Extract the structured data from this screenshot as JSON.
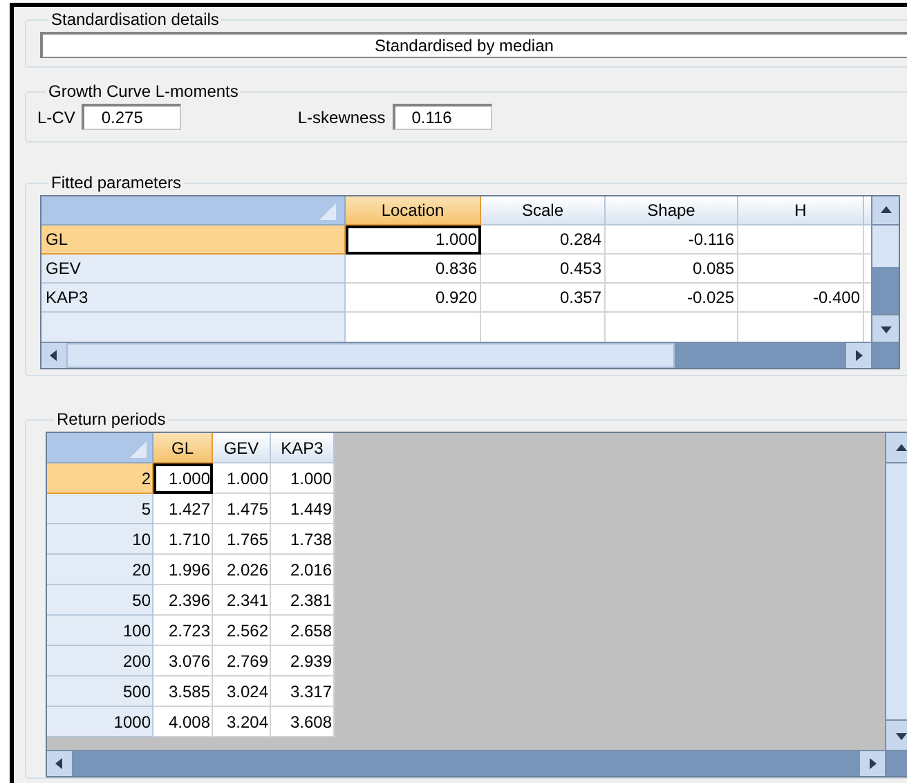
{
  "standardisation": {
    "title": "Standardisation details",
    "value": "Standardised by median"
  },
  "lmoments": {
    "title": "Growth Curve L-moments",
    "fields": [
      {
        "label": "L-CV",
        "value": "0.275"
      },
      {
        "label": "L-skewness",
        "value": "0.116"
      }
    ]
  },
  "fitted_parameters": {
    "title": "Fitted parameters",
    "columns": [
      {
        "label": "Location",
        "selected": true
      },
      {
        "label": "Scale",
        "selected": false
      },
      {
        "label": "Shape",
        "selected": false
      },
      {
        "label": "H",
        "selected": false
      }
    ],
    "rows": [
      {
        "name": "GL",
        "selected": true,
        "cells": [
          "1.000",
          "0.284",
          "-0.116",
          ""
        ]
      },
      {
        "name": "GEV",
        "selected": false,
        "cells": [
          "0.836",
          "0.453",
          "0.085",
          ""
        ]
      },
      {
        "name": "KAP3",
        "selected": false,
        "cells": [
          "0.920",
          "0.357",
          "-0.025",
          "-0.400"
        ]
      }
    ]
  },
  "return_periods": {
    "title": "Return periods",
    "columns": [
      {
        "label": "GL",
        "selected": true
      },
      {
        "label": "GEV",
        "selected": false
      },
      {
        "label": "KAP3",
        "selected": false
      }
    ],
    "rows": [
      {
        "name": "2",
        "selected": true,
        "cells": [
          "1.000",
          "1.000",
          "1.000"
        ]
      },
      {
        "name": "5",
        "selected": false,
        "cells": [
          "1.427",
          "1.475",
          "1.449"
        ]
      },
      {
        "name": "10",
        "selected": false,
        "cells": [
          "1.710",
          "1.765",
          "1.738"
        ]
      },
      {
        "name": "20",
        "selected": false,
        "cells": [
          "1.996",
          "2.026",
          "2.016"
        ]
      },
      {
        "name": "50",
        "selected": false,
        "cells": [
          "2.396",
          "2.341",
          "2.381"
        ]
      },
      {
        "name": "100",
        "selected": false,
        "cells": [
          "2.723",
          "2.562",
          "2.658"
        ]
      },
      {
        "name": "200",
        "selected": false,
        "cells": [
          "3.076",
          "2.769",
          "2.939"
        ]
      },
      {
        "name": "500",
        "selected": false,
        "cells": [
          "3.585",
          "3.024",
          "3.317"
        ]
      },
      {
        "name": "1000",
        "selected": false,
        "cells": [
          "4.008",
          "3.204",
          "3.608"
        ]
      }
    ]
  }
}
